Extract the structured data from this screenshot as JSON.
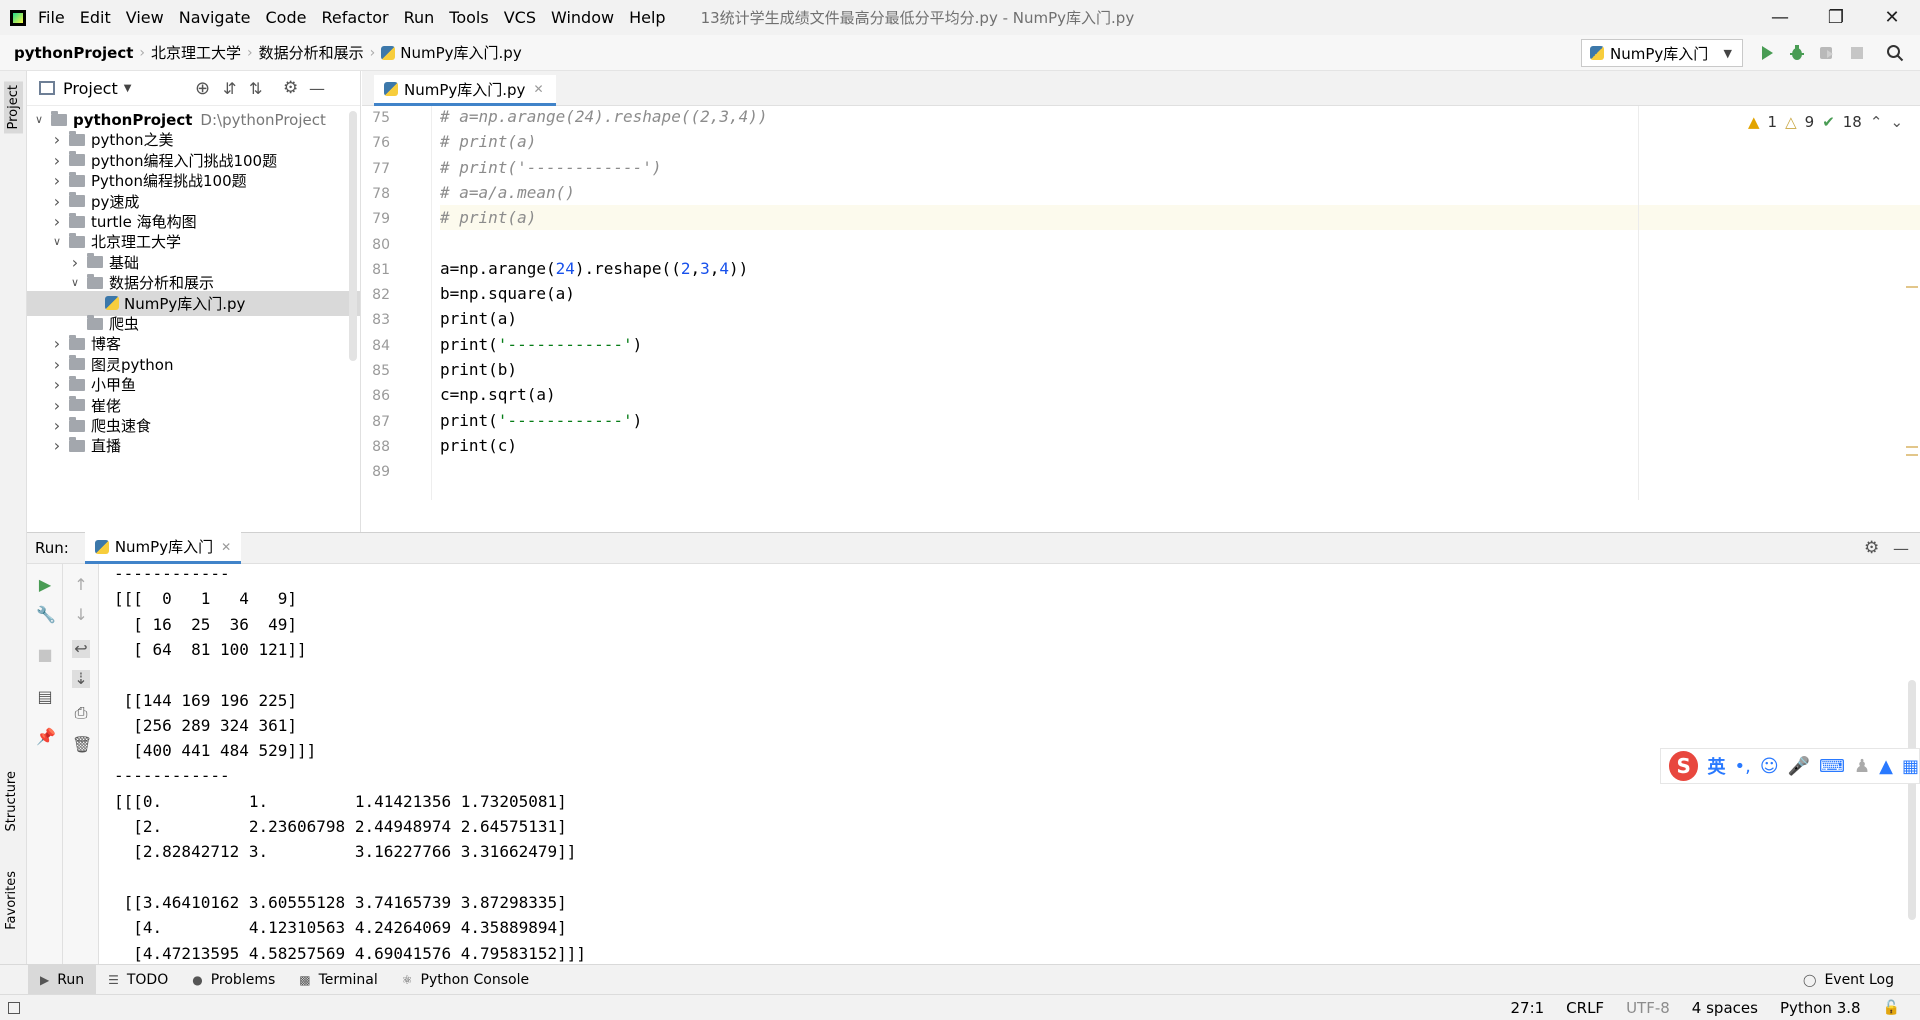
{
  "titlebar": {
    "menu": [
      "File",
      "Edit",
      "View",
      "Navigate",
      "Code",
      "Refactor",
      "Run",
      "Tools",
      "VCS",
      "Window",
      "Help"
    ],
    "window_title": "13统计学生成绩文件最高分最低分平均分.py - NumPy库入门.py"
  },
  "breadcrumbs": [
    "pythonProject",
    "北京理工大学",
    "数据分析和展示",
    "NumPy库入门.py"
  ],
  "run_config": "NumPy库入门",
  "project_panel": {
    "title": "Project",
    "tree": [
      {
        "label": "pythonProject",
        "path": "D:\\pythonProject",
        "depth": 0,
        "arrow": "down",
        "type": "folder",
        "bold": true
      },
      {
        "label": "python之美",
        "depth": 1,
        "arrow": "right",
        "type": "folder"
      },
      {
        "label": "python编程入门挑战100题",
        "depth": 1,
        "arrow": "right",
        "type": "folder"
      },
      {
        "label": "Python编程挑战100题",
        "depth": 1,
        "arrow": "right",
        "type": "folder"
      },
      {
        "label": "py速成",
        "depth": 1,
        "arrow": "right",
        "type": "folder"
      },
      {
        "label": "turtle 海龟构图",
        "depth": 1,
        "arrow": "right",
        "type": "folder"
      },
      {
        "label": "北京理工大学",
        "depth": 1,
        "arrow": "down",
        "type": "folder"
      },
      {
        "label": "基础",
        "depth": 2,
        "arrow": "right",
        "type": "folder"
      },
      {
        "label": "数据分析和展示",
        "depth": 2,
        "arrow": "down",
        "type": "folder"
      },
      {
        "label": "NumPy库入门.py",
        "depth": 3,
        "arrow": "",
        "type": "py",
        "selected": true
      },
      {
        "label": "爬虫",
        "depth": 2,
        "arrow": "",
        "type": "folder"
      },
      {
        "label": "博客",
        "depth": 1,
        "arrow": "right",
        "type": "folder"
      },
      {
        "label": "图灵python",
        "depth": 1,
        "arrow": "right",
        "type": "folder"
      },
      {
        "label": "小甲鱼",
        "depth": 1,
        "arrow": "right",
        "type": "folder"
      },
      {
        "label": "崔佬",
        "depth": 1,
        "arrow": "right",
        "type": "folder"
      },
      {
        "label": "爬虫速食",
        "depth": 1,
        "arrow": "right",
        "type": "folder"
      },
      {
        "label": "直播",
        "depth": 1,
        "arrow": "right",
        "type": "folder"
      }
    ]
  },
  "editor": {
    "tab_label": "NumPy库入门.py",
    "inspection": {
      "warnings": "1",
      "weak_warnings": "9",
      "typos": "18"
    },
    "lines": [
      {
        "no": "75",
        "text": "# a=np.arange(24).reshape((2,3,4))",
        "kind": "comment"
      },
      {
        "no": "76",
        "text": "# print(a)",
        "kind": "comment"
      },
      {
        "no": "77",
        "text": "# print('------------')",
        "kind": "comment"
      },
      {
        "no": "78",
        "text": "# a=a/a.mean()",
        "kind": "comment"
      },
      {
        "no": "79",
        "text": "# print(a)",
        "kind": "comment",
        "current": true
      },
      {
        "no": "80",
        "text": "",
        "kind": "plain"
      },
      {
        "no": "81",
        "text": "a=np.arange(24).reshape((2,3,4))",
        "kind": "code"
      },
      {
        "no": "82",
        "text": "b=np.square(a)",
        "kind": "code"
      },
      {
        "no": "83",
        "text": "print(a)",
        "kind": "code"
      },
      {
        "no": "84",
        "text": "print('------------')",
        "kind": "code"
      },
      {
        "no": "85",
        "text": "print(b)",
        "kind": "code"
      },
      {
        "no": "86",
        "text": "c=np.sqrt(a)",
        "kind": "code"
      },
      {
        "no": "87",
        "text": "print('------------')",
        "kind": "code"
      },
      {
        "no": "88",
        "text": "print(c)",
        "kind": "code"
      },
      {
        "no": "89",
        "text": "",
        "kind": "plain"
      }
    ]
  },
  "run_panel": {
    "label": "Run:",
    "tab_label": "NumPy库入门",
    "console_lines": [
      "------------",
      "[[[  0   1   4   9]",
      "  [ 16  25  36  49]",
      "  [ 64  81 100 121]]",
      "",
      " [[144 169 196 225]",
      "  [256 289 324 361]",
      "  [400 441 484 529]]]",
      "------------",
      "[[[0.         1.         1.41421356 1.73205081]",
      "  [2.         2.23606798 2.44948974 2.64575131]",
      "  [2.82842712 3.         3.16227766 3.31662479]]",
      "",
      " [[3.46410162 3.60555128 3.74165739 3.87298335]",
      "  [4.         4.12310563 4.24264069 4.35889894]",
      "  [4.47213595 4.58257569 4.69041576 4.79583152]]]"
    ]
  },
  "stripes": {
    "project": "Project",
    "structure": "Structure",
    "favorites": "Favorites"
  },
  "bottom_bar": {
    "run": "Run",
    "todo": "TODO",
    "problems": "Problems",
    "terminal": "Terminal",
    "python_console": "Python Console",
    "event_log": "Event Log"
  },
  "status_bar": {
    "position": "27:1",
    "line_sep": "CRLF",
    "encoding": "UTF-8",
    "indent": "4 spaces",
    "interpreter": "Python 3.8"
  },
  "ime": {
    "logo": "S",
    "lang": "英",
    "punct": "•,"
  },
  "colors": {
    "accent": "#4083c9",
    "run_green": "#499c54",
    "warning": "#e2a400"
  }
}
